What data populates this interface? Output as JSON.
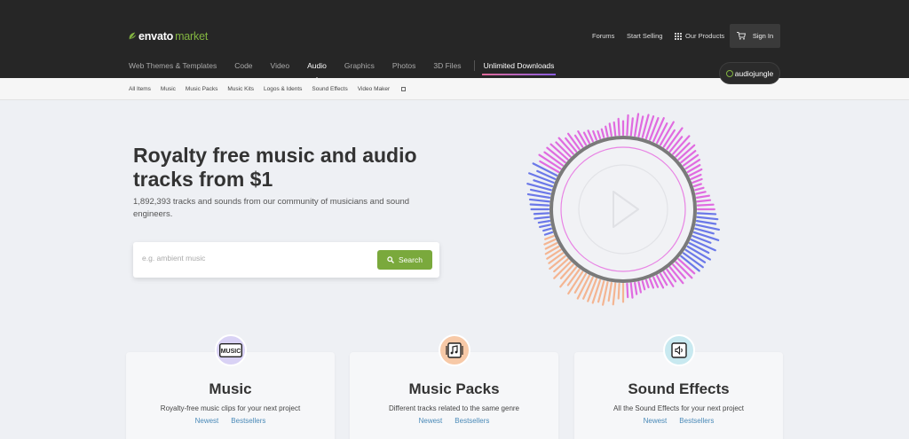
{
  "header": {
    "logo": {
      "brand": "envato",
      "suffix": "market"
    },
    "links": {
      "forums": "Forums",
      "start_selling": "Start Selling",
      "our_products": "Our Products"
    },
    "sign_in": "Sign In",
    "nav": [
      "Web Themes & Templates",
      "Code",
      "Video",
      "Audio",
      "Graphics",
      "Photos",
      "3D Files"
    ],
    "nav_active": "Audio",
    "unlimited": "Unlimited Downloads",
    "badge": "audiojungle"
  },
  "subnav": {
    "items": [
      "All Items",
      "Music",
      "Music Packs",
      "Music Kits",
      "Logos & Idents",
      "Sound Effects"
    ],
    "external": "Video Maker"
  },
  "hero": {
    "title": "Royalty free music and audio tracks from $1",
    "subtitle": "1,892,393 tracks and sounds from our community of musicians and sound engineers."
  },
  "search": {
    "placeholder": "e.g. ambient music",
    "value": "",
    "button": "Search"
  },
  "cards": [
    {
      "icon_text": "MUSIC",
      "icon_color": "#d9d2f5",
      "title": "Music",
      "desc": "Royalty-free music clips for your next project",
      "links": [
        "Newest",
        "Bestsellers"
      ]
    },
    {
      "icon_text": "",
      "icon_color": "#f7c9a7",
      "title": "Music Packs",
      "desc": "Different tracks related to the same genre",
      "links": [
        "Newest",
        "Bestsellers"
      ]
    },
    {
      "icon_text": "",
      "icon_color": "#c8e9f0",
      "title": "Sound Effects",
      "desc": "All the Sound Effects for your next project",
      "links": [
        "Newest",
        "Bestsellers"
      ]
    }
  ],
  "colors": {
    "header_bg": "#262626",
    "accent_green": "#82b440",
    "search_button": "#7aa93c",
    "link_blue": "#4a8ab8",
    "wave_pink": "#e06be0",
    "wave_blue": "#6b78e8",
    "wave_peach": "#f4b592"
  }
}
